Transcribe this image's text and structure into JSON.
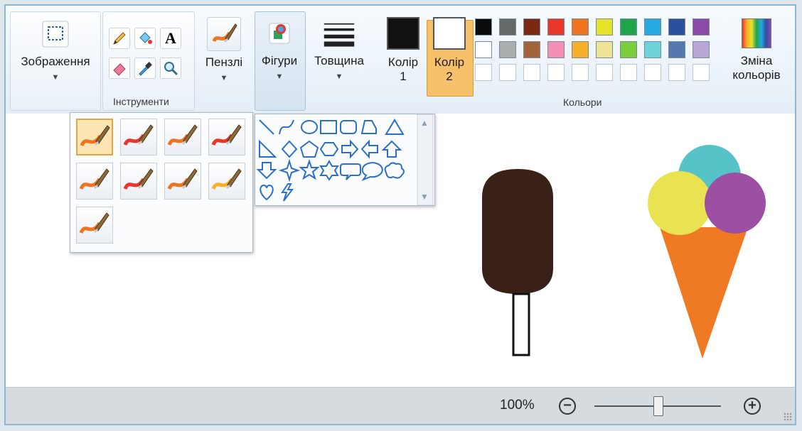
{
  "ribbon": {
    "image_group": {
      "label": "Зображення"
    },
    "tools_group": {
      "label": "Інструменти"
    },
    "brushes": {
      "label": "Пензлі"
    },
    "shapes": {
      "label": "Фігури"
    },
    "thickness": {
      "label": "Товщина"
    },
    "color1": {
      "label_line1": "Колір",
      "label_line2": "1",
      "value": "#111111"
    },
    "color2": {
      "label_line1": "Колір",
      "label_line2": "2",
      "value": "#ffffff"
    },
    "colors_group": {
      "label": "Кольори"
    },
    "edit_colors": {
      "label_line1": "Зміна",
      "label_line2": "кольорів"
    },
    "tool_icons": [
      "pencil-icon",
      "fill-bucket-icon",
      "text-icon",
      "eraser-icon",
      "color-picker-icon",
      "magnifier-icon"
    ]
  },
  "palette": {
    "row1": [
      "#0b0b0b",
      "#646a66",
      "#7a2a12",
      "#e9352a",
      "#f0731f",
      "#e7e12a",
      "#1fa54a",
      "#25a9e0",
      "#2d4fa0",
      "#8b4aa8"
    ],
    "row2": [
      "#ffffff",
      "#a9b0ab",
      "#a5633a",
      "#f38fb5",
      "#f7b02a",
      "#efe396",
      "#7ccf3c",
      "#6fd3dc",
      "#5479ae",
      "#b9a6d6"
    ],
    "row3_empty": 10
  },
  "status": {
    "zoom": "100%",
    "zoom_level": 0.5
  },
  "brush_menu": {
    "count": 9,
    "selected_index": 0
  },
  "shapes_menu": {
    "items": [
      "line",
      "curve",
      "oval",
      "rectangle",
      "rounded-rectangle",
      "polygon",
      "triangle",
      "right-triangle",
      "diamond",
      "pentagon",
      "hexagon",
      "right-arrow",
      "left-arrow",
      "up-arrow",
      "down-arrow",
      "four-point-star",
      "five-point-star",
      "six-point-star",
      "rounded-callout",
      "oval-callout",
      "cloud-callout",
      "heart",
      "lightning"
    ]
  },
  "drawing": {
    "popsicle_color": "#3a2118",
    "ice_cream_scoops": [
      "#55c3c7",
      "#e9e251",
      "#9c4fa3"
    ],
    "cone_color": "#f07a23"
  }
}
